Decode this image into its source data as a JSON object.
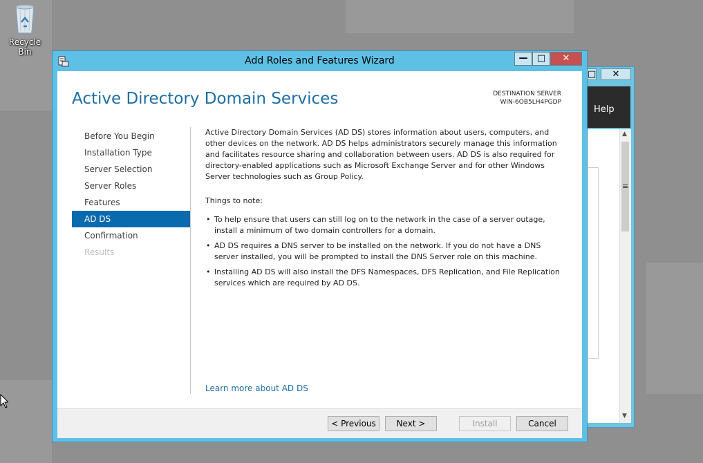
{
  "desktop": {
    "recycle_bin_label": "Recycle Bin"
  },
  "background_window": {
    "help_label": "Help",
    "min_label": "□",
    "close_label": "✕"
  },
  "wizard": {
    "title": "Add Roles and Features Wizard",
    "window_buttons": {
      "minimize": "—",
      "maximize": "□",
      "close": "✕"
    },
    "heading": "Active Directory Domain Services",
    "destination_label": "DESTINATION SERVER",
    "destination_server": "WIN-6OB5LH4PGDP",
    "nav_items": [
      {
        "label": "Before You Begin",
        "state": "normal"
      },
      {
        "label": "Installation Type",
        "state": "normal"
      },
      {
        "label": "Server Selection",
        "state": "normal"
      },
      {
        "label": "Server Roles",
        "state": "normal"
      },
      {
        "label": "Features",
        "state": "normal"
      },
      {
        "label": "AD DS",
        "state": "active"
      },
      {
        "label": "Confirmation",
        "state": "normal"
      },
      {
        "label": "Results",
        "state": "disabled"
      }
    ],
    "description": "Active Directory Domain Services (AD DS) stores information about users, computers, and other devices on the network.  AD DS helps administrators securely manage this information and facilitates resource sharing and collaboration between users.  AD DS is also required for directory-enabled applications such as Microsoft Exchange Server and for other Windows Server technologies such as Group Policy.",
    "things_to_note_label": "Things to note:",
    "notes": [
      "To help ensure that users can still log on to the network in the case of a server outage, install a minimum of two domain controllers for a domain.",
      "AD DS requires a DNS server to be installed on the network.  If you do not have a DNS server installed, you will be prompted to install the DNS Server role on this machine.",
      "Installing AD DS will also install the DFS Namespaces, DFS Replication, and File Replication services which are required by AD DS."
    ],
    "learn_more_link": "Learn more about AD DS",
    "buttons": {
      "previous": "< Previous",
      "next": "Next >",
      "install": "Install",
      "cancel": "Cancel"
    }
  },
  "colors": {
    "window_frame": "#5fc0e6",
    "accent": "#1e6fa5",
    "nav_active": "#0a6aae",
    "close_button": "#c75050"
  }
}
